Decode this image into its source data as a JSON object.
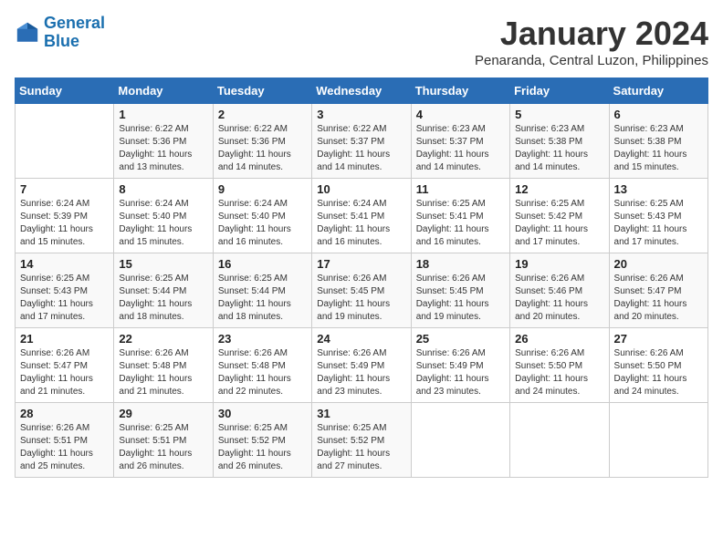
{
  "logo": {
    "line1": "General",
    "line2": "Blue"
  },
  "title": "January 2024",
  "subtitle": "Penaranda, Central Luzon, Philippines",
  "days_of_week": [
    "Sunday",
    "Monday",
    "Tuesday",
    "Wednesday",
    "Thursday",
    "Friday",
    "Saturday"
  ],
  "weeks": [
    [
      {
        "num": "",
        "sunrise": "",
        "sunset": "",
        "daylight": ""
      },
      {
        "num": "1",
        "sunrise": "Sunrise: 6:22 AM",
        "sunset": "Sunset: 5:36 PM",
        "daylight": "Daylight: 11 hours and 13 minutes."
      },
      {
        "num": "2",
        "sunrise": "Sunrise: 6:22 AM",
        "sunset": "Sunset: 5:36 PM",
        "daylight": "Daylight: 11 hours and 14 minutes."
      },
      {
        "num": "3",
        "sunrise": "Sunrise: 6:22 AM",
        "sunset": "Sunset: 5:37 PM",
        "daylight": "Daylight: 11 hours and 14 minutes."
      },
      {
        "num": "4",
        "sunrise": "Sunrise: 6:23 AM",
        "sunset": "Sunset: 5:37 PM",
        "daylight": "Daylight: 11 hours and 14 minutes."
      },
      {
        "num": "5",
        "sunrise": "Sunrise: 6:23 AM",
        "sunset": "Sunset: 5:38 PM",
        "daylight": "Daylight: 11 hours and 14 minutes."
      },
      {
        "num": "6",
        "sunrise": "Sunrise: 6:23 AM",
        "sunset": "Sunset: 5:38 PM",
        "daylight": "Daylight: 11 hours and 15 minutes."
      }
    ],
    [
      {
        "num": "7",
        "sunrise": "Sunrise: 6:24 AM",
        "sunset": "Sunset: 5:39 PM",
        "daylight": "Daylight: 11 hours and 15 minutes."
      },
      {
        "num": "8",
        "sunrise": "Sunrise: 6:24 AM",
        "sunset": "Sunset: 5:40 PM",
        "daylight": "Daylight: 11 hours and 15 minutes."
      },
      {
        "num": "9",
        "sunrise": "Sunrise: 6:24 AM",
        "sunset": "Sunset: 5:40 PM",
        "daylight": "Daylight: 11 hours and 16 minutes."
      },
      {
        "num": "10",
        "sunrise": "Sunrise: 6:24 AM",
        "sunset": "Sunset: 5:41 PM",
        "daylight": "Daylight: 11 hours and 16 minutes."
      },
      {
        "num": "11",
        "sunrise": "Sunrise: 6:25 AM",
        "sunset": "Sunset: 5:41 PM",
        "daylight": "Daylight: 11 hours and 16 minutes."
      },
      {
        "num": "12",
        "sunrise": "Sunrise: 6:25 AM",
        "sunset": "Sunset: 5:42 PM",
        "daylight": "Daylight: 11 hours and 17 minutes."
      },
      {
        "num": "13",
        "sunrise": "Sunrise: 6:25 AM",
        "sunset": "Sunset: 5:43 PM",
        "daylight": "Daylight: 11 hours and 17 minutes."
      }
    ],
    [
      {
        "num": "14",
        "sunrise": "Sunrise: 6:25 AM",
        "sunset": "Sunset: 5:43 PM",
        "daylight": "Daylight: 11 hours and 17 minutes."
      },
      {
        "num": "15",
        "sunrise": "Sunrise: 6:25 AM",
        "sunset": "Sunset: 5:44 PM",
        "daylight": "Daylight: 11 hours and 18 minutes."
      },
      {
        "num": "16",
        "sunrise": "Sunrise: 6:25 AM",
        "sunset": "Sunset: 5:44 PM",
        "daylight": "Daylight: 11 hours and 18 minutes."
      },
      {
        "num": "17",
        "sunrise": "Sunrise: 6:26 AM",
        "sunset": "Sunset: 5:45 PM",
        "daylight": "Daylight: 11 hours and 19 minutes."
      },
      {
        "num": "18",
        "sunrise": "Sunrise: 6:26 AM",
        "sunset": "Sunset: 5:45 PM",
        "daylight": "Daylight: 11 hours and 19 minutes."
      },
      {
        "num": "19",
        "sunrise": "Sunrise: 6:26 AM",
        "sunset": "Sunset: 5:46 PM",
        "daylight": "Daylight: 11 hours and 20 minutes."
      },
      {
        "num": "20",
        "sunrise": "Sunrise: 6:26 AM",
        "sunset": "Sunset: 5:47 PM",
        "daylight": "Daylight: 11 hours and 20 minutes."
      }
    ],
    [
      {
        "num": "21",
        "sunrise": "Sunrise: 6:26 AM",
        "sunset": "Sunset: 5:47 PM",
        "daylight": "Daylight: 11 hours and 21 minutes."
      },
      {
        "num": "22",
        "sunrise": "Sunrise: 6:26 AM",
        "sunset": "Sunset: 5:48 PM",
        "daylight": "Daylight: 11 hours and 21 minutes."
      },
      {
        "num": "23",
        "sunrise": "Sunrise: 6:26 AM",
        "sunset": "Sunset: 5:48 PM",
        "daylight": "Daylight: 11 hours and 22 minutes."
      },
      {
        "num": "24",
        "sunrise": "Sunrise: 6:26 AM",
        "sunset": "Sunset: 5:49 PM",
        "daylight": "Daylight: 11 hours and 23 minutes."
      },
      {
        "num": "25",
        "sunrise": "Sunrise: 6:26 AM",
        "sunset": "Sunset: 5:49 PM",
        "daylight": "Daylight: 11 hours and 23 minutes."
      },
      {
        "num": "26",
        "sunrise": "Sunrise: 6:26 AM",
        "sunset": "Sunset: 5:50 PM",
        "daylight": "Daylight: 11 hours and 24 minutes."
      },
      {
        "num": "27",
        "sunrise": "Sunrise: 6:26 AM",
        "sunset": "Sunset: 5:50 PM",
        "daylight": "Daylight: 11 hours and 24 minutes."
      }
    ],
    [
      {
        "num": "28",
        "sunrise": "Sunrise: 6:26 AM",
        "sunset": "Sunset: 5:51 PM",
        "daylight": "Daylight: 11 hours and 25 minutes."
      },
      {
        "num": "29",
        "sunrise": "Sunrise: 6:25 AM",
        "sunset": "Sunset: 5:51 PM",
        "daylight": "Daylight: 11 hours and 26 minutes."
      },
      {
        "num": "30",
        "sunrise": "Sunrise: 6:25 AM",
        "sunset": "Sunset: 5:52 PM",
        "daylight": "Daylight: 11 hours and 26 minutes."
      },
      {
        "num": "31",
        "sunrise": "Sunrise: 6:25 AM",
        "sunset": "Sunset: 5:52 PM",
        "daylight": "Daylight: 11 hours and 27 minutes."
      },
      {
        "num": "",
        "sunrise": "",
        "sunset": "",
        "daylight": ""
      },
      {
        "num": "",
        "sunrise": "",
        "sunset": "",
        "daylight": ""
      },
      {
        "num": "",
        "sunrise": "",
        "sunset": "",
        "daylight": ""
      }
    ]
  ]
}
